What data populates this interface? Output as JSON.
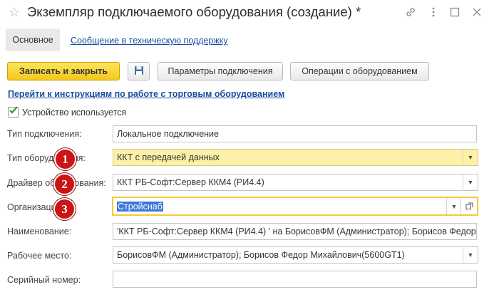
{
  "header": {
    "title": "Экземпляр подключаемого оборудования (создание) *",
    "icons": [
      "star-icon",
      "link-icon",
      "more-icon",
      "maximize-icon",
      "close-icon"
    ]
  },
  "tabs": {
    "main": "Основное",
    "support": "Сообщение в техническую поддержку"
  },
  "toolbar": {
    "save_close": "Записать и закрыть",
    "conn_params": "Параметры подключения",
    "operations": "Операции с оборудованием"
  },
  "instructions_link": "Перейти к инструкциям по работе с торговым оборудованием",
  "device_used": {
    "label": "Устройство используется",
    "checked": true
  },
  "form": {
    "connection_type": {
      "label": "Тип подключения:",
      "value": "Локальное подключение"
    },
    "equipment_type": {
      "label": "Тип оборудования:",
      "value": "ККТ с передачей данных"
    },
    "driver": {
      "label": "Драйвер оборудования:",
      "value": "ККТ РБ-Софт:Сервер ККМ4 (РИ4.4)"
    },
    "organization": {
      "label": "Организация:",
      "value": "Стройснаб"
    },
    "name": {
      "label": "Наименование:",
      "value": "'ККТ РБ-Софт:Сервер ККМ4 (РИ4.4) ' на БорисовФМ (Администратор); Борисов Федор"
    },
    "workplace": {
      "label": "Рабочее место:",
      "value": "БорисовФМ (Администратор); Борисов Федор Михайлович(5600GT1)"
    },
    "serial": {
      "label": "Серийный номер:",
      "value": ""
    }
  },
  "badges": [
    "1",
    "2",
    "3"
  ],
  "colors": {
    "primary_button": "#f2c81a",
    "link": "#1a4fa0",
    "badge": "#c91515",
    "highlight_field": "#fdf0a8"
  }
}
